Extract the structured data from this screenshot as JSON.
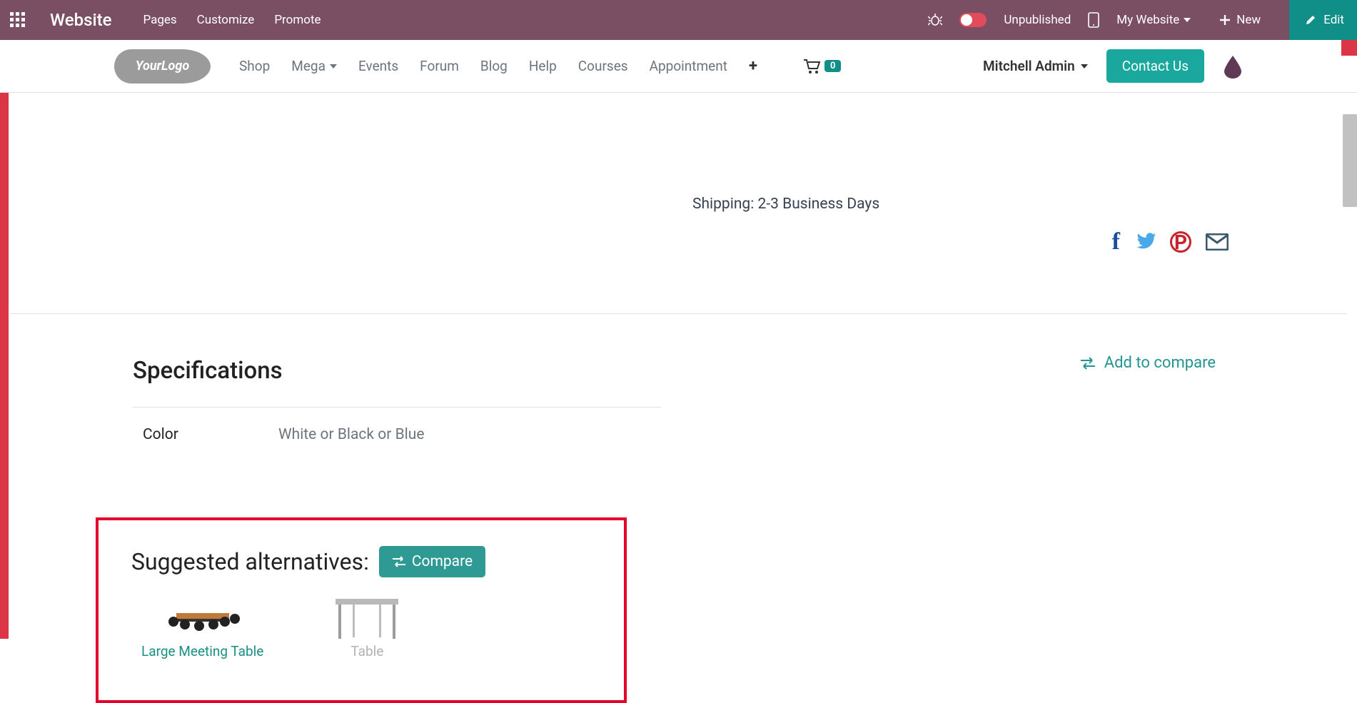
{
  "topbar": {
    "title": "Website",
    "pages": "Pages",
    "customize": "Customize",
    "promote": "Promote",
    "unpublished": "Unpublished",
    "my_website": "My Website",
    "new": "New",
    "edit": "Edit"
  },
  "sitebar": {
    "logo_text": "YourLogo",
    "nav": {
      "shop": "Shop",
      "mega": "Mega",
      "events": "Events",
      "forum": "Forum",
      "blog": "Blog",
      "help": "Help",
      "courses": "Courses",
      "appointment": "Appointment"
    },
    "cart_count": "0",
    "user": "Mitchell Admin",
    "contact": "Contact Us"
  },
  "product": {
    "shipping_line": "Shipping: 2-3 Business Days"
  },
  "specs": {
    "title": "Specifications",
    "add_compare": "Add to compare",
    "rows": [
      {
        "key": "Color",
        "value": "White or Black or Blue"
      }
    ]
  },
  "alternatives": {
    "title": "Suggested alternatives:",
    "compare_btn": "Compare",
    "items": [
      {
        "label": "Large Meeting Table"
      },
      {
        "label": "Table"
      }
    ]
  }
}
